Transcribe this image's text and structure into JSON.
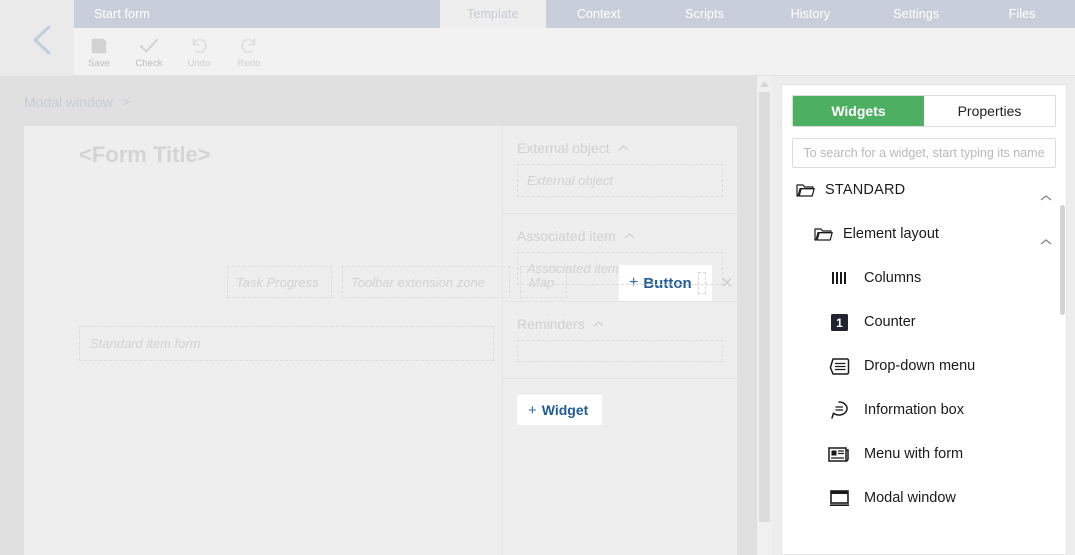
{
  "header": {
    "back_icon": "chevron-left-icon",
    "tabs": [
      {
        "label": "Start form",
        "active": false
      },
      {
        "label": "Template",
        "active": true
      },
      {
        "label": "Context",
        "active": false
      },
      {
        "label": "Scripts",
        "active": false
      },
      {
        "label": "History",
        "active": false
      },
      {
        "label": "Settings",
        "active": false
      },
      {
        "label": "Files",
        "active": false
      }
    ],
    "toolbar": [
      {
        "label": "Save",
        "icon": "save-floppy-icon",
        "enabled": true
      },
      {
        "label": "Check",
        "icon": "checkmark-icon",
        "enabled": true
      },
      {
        "label": "Undo",
        "icon": "undo-arrow-icon",
        "enabled": false
      },
      {
        "label": "Redo",
        "icon": "redo-arrow-icon",
        "enabled": false
      }
    ]
  },
  "stage": {
    "breadcrumb": {
      "root": "Modal window",
      "separator": ">"
    },
    "form": {
      "title": "<Form Title>",
      "dropzones": {
        "task_progress": "Task Progress",
        "toolbar_extension": "Toolbar extension zone",
        "map": "Map",
        "standard_item_form": "Standard item form"
      },
      "drag_handle_icon": "vertical-dots-icon",
      "close_icon": "close-x-icon",
      "button_card": {
        "plus": "+",
        "label": "Button"
      },
      "sections": [
        {
          "title": "External object",
          "chevron": "chevron-up-icon",
          "dropzone": "External object"
        },
        {
          "title": "Associated item",
          "chevron": "chevron-up-icon",
          "dropzone": "Associated item"
        },
        {
          "title": "Reminders",
          "chevron": "chevron-up-icon",
          "dropzone": ""
        }
      ],
      "add_widget": {
        "plus": "+",
        "label": "Widget"
      }
    },
    "scrollbar": {
      "arrow_icon": "scroll-up-arrow-icon"
    }
  },
  "panel": {
    "tabs": [
      {
        "label": "Widgets",
        "selected": true
      },
      {
        "label": "Properties",
        "selected": false
      }
    ],
    "search": {
      "value": "",
      "placeholder": "To search for a widget, start typing its name",
      "icon": "search-icon"
    },
    "groups": [
      {
        "label": "STANDARD",
        "level": 0,
        "folder_icon": "folder-open-icon",
        "chevron": "chevron-up-icon"
      },
      {
        "label": "Element layout",
        "level": 1,
        "folder_icon": "folder-open-icon",
        "chevron": "chevron-up-icon"
      }
    ],
    "widgets": [
      {
        "label": "Columns",
        "icon": "columns-icon"
      },
      {
        "label": "Counter",
        "icon": "counter-icon"
      },
      {
        "label": "Drop-down menu",
        "icon": "drop-down-menu-icon"
      },
      {
        "label": "Information box",
        "icon": "information-box-icon"
      },
      {
        "label": "Menu with form",
        "icon": "menu-with-form-icon"
      },
      {
        "label": "Modal window",
        "icon": "modal-window-icon"
      }
    ]
  },
  "colors": {
    "accent_green": "#4caf62",
    "link_blue": "#1f5c99",
    "tab_bar": "#c9cfda",
    "canvas": "#e0e0e0"
  }
}
